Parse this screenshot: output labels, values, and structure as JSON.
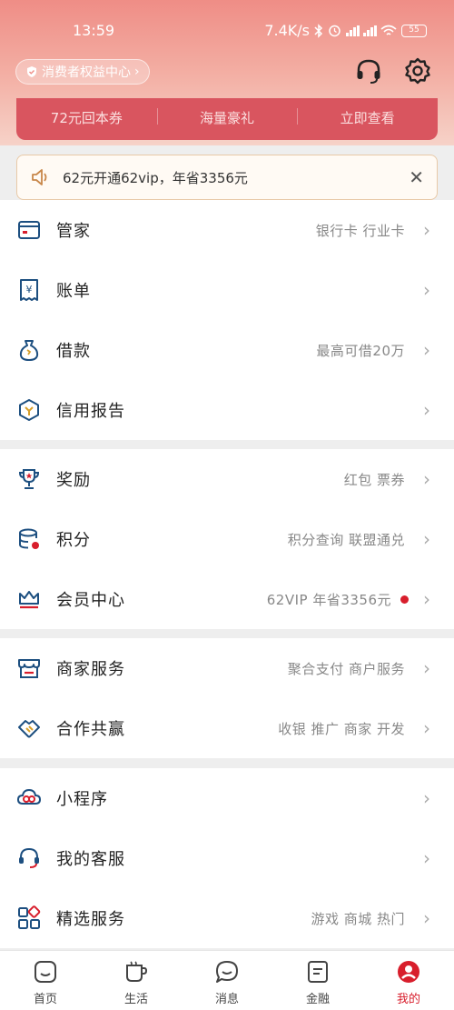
{
  "status": {
    "time": "13:59",
    "speed": "7.4K/s",
    "battery": "55"
  },
  "header": {
    "consumer_center": "消费者权益中心",
    "icons": [
      "headset-icon",
      "settings-icon"
    ]
  },
  "promo_strip": [
    "72元回本券",
    "海量豪礼",
    "立即查看"
  ],
  "notice": {
    "text": "62元开通62vip，年省3356元"
  },
  "sections": [
    {
      "items": [
        {
          "title": "管家",
          "sub": "银行卡 行业卡",
          "icon": "wallet-card-icon"
        },
        {
          "title": "账单",
          "sub": "",
          "icon": "bill-icon"
        },
        {
          "title": "借款",
          "sub": "最高可借20万",
          "icon": "money-bag-icon"
        },
        {
          "title": "信用报告",
          "sub": "",
          "icon": "credit-report-icon"
        }
      ]
    },
    {
      "items": [
        {
          "title": "奖励",
          "sub": "红包 票券",
          "icon": "trophy-icon"
        },
        {
          "title": "积分",
          "sub": "积分查询 联盟通兑",
          "icon": "points-icon"
        },
        {
          "title": "会员中心",
          "sub": "62VIP 年省3356元",
          "icon": "crown-icon"
        }
      ]
    },
    {
      "items": [
        {
          "title": "商家服务",
          "sub": "聚合支付 商户服务",
          "icon": "store-icon"
        },
        {
          "title": "合作共赢",
          "sub": "收银 推广 商家 开发",
          "icon": "handshake-icon"
        }
      ]
    },
    {
      "items": [
        {
          "title": "小程序",
          "sub": "",
          "icon": "mini-program-icon"
        },
        {
          "title": "我的客服",
          "sub": "",
          "icon": "service-icon"
        },
        {
          "title": "精选服务",
          "sub": "游戏 商城 热门",
          "icon": "grid-icon"
        }
      ]
    }
  ],
  "tabbar": [
    {
      "label": "首页",
      "icon": "home-icon"
    },
    {
      "label": "生活",
      "icon": "cup-icon"
    },
    {
      "label": "消息",
      "icon": "message-icon"
    },
    {
      "label": "金融",
      "icon": "finance-icon"
    },
    {
      "label": "我的",
      "icon": "profile-icon"
    }
  ],
  "colors": {
    "accent": "#d81e2c",
    "promo_bg": "#d9555f",
    "header_gradient_top": "#ef8d86"
  }
}
